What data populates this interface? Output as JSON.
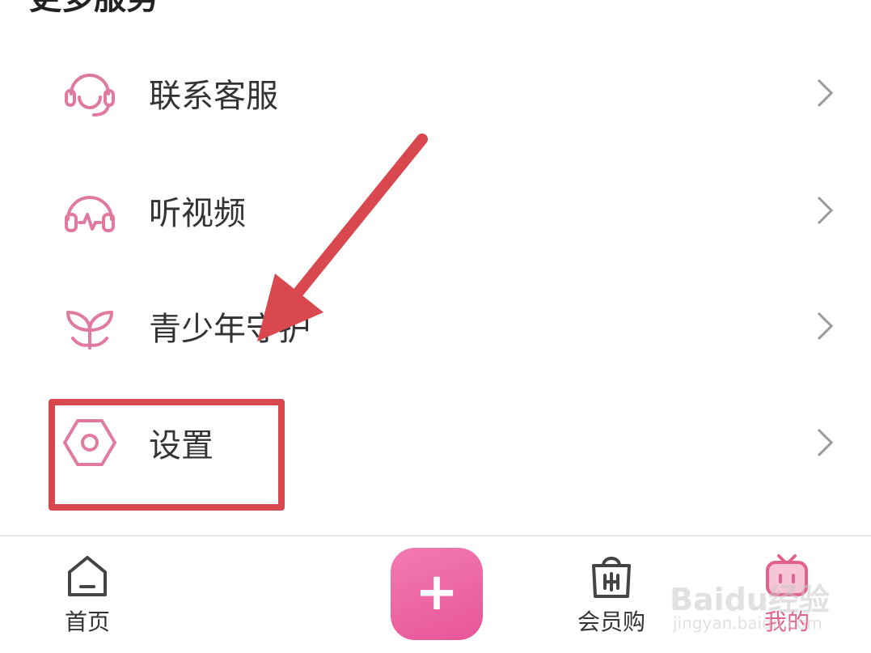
{
  "section": {
    "title": "更多服务"
  },
  "menu": {
    "items": [
      {
        "label": "联系客服",
        "icon": "headset-service-icon"
      },
      {
        "label": "听视频",
        "icon": "headphones-icon"
      },
      {
        "label": "青少年守护",
        "icon": "sprout-icon"
      },
      {
        "label": "设置",
        "icon": "settings-hex-icon"
      }
    ]
  },
  "tabbar": {
    "home_label": "首页",
    "shop_label": "会员购",
    "mine_label": "我的",
    "add_label": "+"
  },
  "watermark": {
    "text": "Baidu经验",
    "sub": "jingyan.baidu.com"
  },
  "colors": {
    "accent": "#e5618d",
    "annotation": "#d9474f",
    "plus_gradient_start": "#f27bb0",
    "plus_gradient_end": "#e8559a"
  }
}
